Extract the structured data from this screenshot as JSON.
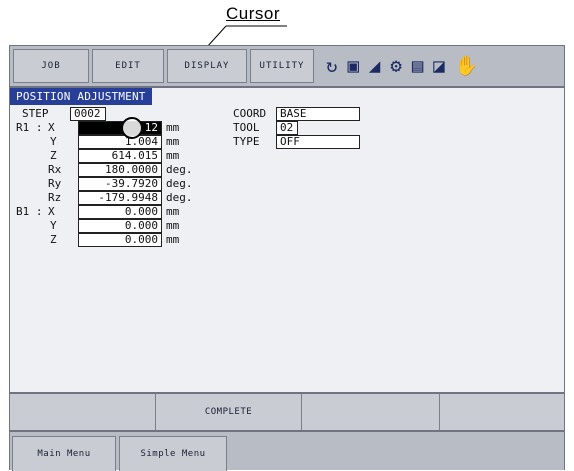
{
  "annotation": {
    "label": "Cursor"
  },
  "menu": {
    "job": "JOB",
    "edit": "EDIT",
    "display": "DISPLAY",
    "utility": "UTILITY"
  },
  "status_icons": [
    "cycle-icon",
    "edit-mode-icon",
    "signal-icon",
    "robot-icon",
    "display-icon",
    "dialog-icon",
    "hand-icon"
  ],
  "panel": {
    "title": "POSITION ADJUSTMENT",
    "step_label": "STEP",
    "step_value": "0002",
    "coord_label": "COORD",
    "coord_value": "BASE",
    "tool_label": "TOOL",
    "tool_value": "02",
    "type_label": "TYPE",
    "type_value": "OFF",
    "rows": [
      {
        "prefix": "R1 :",
        "axis": "X",
        "value": "12",
        "unit": "mm"
      },
      {
        "prefix": "",
        "axis": "Y",
        "value": "1.004",
        "unit": "mm"
      },
      {
        "prefix": "",
        "axis": "Z",
        "value": "614.015",
        "unit": "mm"
      },
      {
        "prefix": "",
        "axis": "Rx",
        "value": "180.0000",
        "unit": "deg."
      },
      {
        "prefix": "",
        "axis": "Ry",
        "value": "-39.7920",
        "unit": "deg."
      },
      {
        "prefix": "",
        "axis": "Rz",
        "value": "-179.9948",
        "unit": "deg."
      },
      {
        "prefix": "B1 :",
        "axis": "X",
        "value": "0.000",
        "unit": "mm"
      },
      {
        "prefix": "",
        "axis": "Y",
        "value": "0.000",
        "unit": "mm"
      },
      {
        "prefix": "",
        "axis": "Z",
        "value": "0.000",
        "unit": "mm"
      }
    ]
  },
  "function_keys": [
    "",
    "COMPLETE",
    "",
    ""
  ],
  "bottom": {
    "main_menu": "Main Menu",
    "simple_menu": "Simple Menu"
  },
  "colors": {
    "title_bar": "#283f9a",
    "panel_bg": "#eef0f4",
    "button": "#c9ccd3"
  }
}
